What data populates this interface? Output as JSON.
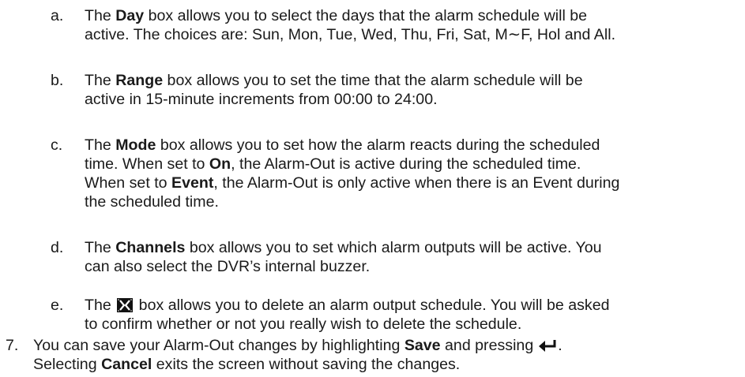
{
  "list_items": [
    {
      "marker": "a.",
      "lines": [
        {
          "pre": "The ",
          "bold": "Day",
          "post": " box allows you to select the days that the alarm schedule will be"
        },
        {
          "text": "active. The choices are: Sun, Mon, Tue, Wed, Thu, Fri, Sat, M∼F, Hol and All."
        }
      ]
    },
    {
      "marker": "b.",
      "lines": [
        {
          "pre": "The ",
          "bold": "Range",
          "post": " box allows you to set the time that the alarm schedule will be"
        },
        {
          "text": "active in 15-minute increments from 00:00 to 24:00."
        }
      ]
    },
    {
      "marker": "c.",
      "lines": [
        {
          "pre": "The ",
          "bold": "Mode",
          "post": " box allows you to set how the alarm reacts during the scheduled"
        },
        {
          "pre": "time. When set to ",
          "bold": "On",
          "post": ", the Alarm-Out is active during the scheduled time."
        },
        {
          "pre": "When set to ",
          "bold": "Event",
          "post": ", the Alarm-Out is only active when there is an Event during"
        },
        {
          "text": "the scheduled time."
        }
      ]
    },
    {
      "marker": "d.",
      "lines": [
        {
          "pre": "The ",
          "bold": "Channels",
          "post": " box allows you to set which alarm outputs will be active. You"
        },
        {
          "text": "can also select the DVR’s internal buzzer."
        }
      ]
    },
    {
      "marker": "e.",
      "lines": [
        {
          "pre": "The",
          "icon": "x-delete-icon",
          "post": "box allows you to delete an alarm output schedule. You will be asked"
        },
        {
          "text": "to confirm whether or not you really wish to delete the schedule."
        }
      ]
    }
  ],
  "step7": {
    "marker": "7.",
    "line1_pre": "You can save your Alarm-Out changes by highlighting ",
    "line1_bold": "Save",
    "line1_post": " and pressing",
    "line1_icon": "enter-arrow-icon",
    "line1_end": ".",
    "line2_pre": "Selecting ",
    "line2_bold": "Cancel",
    "line2_post": " exits the screen without saving the changes."
  }
}
